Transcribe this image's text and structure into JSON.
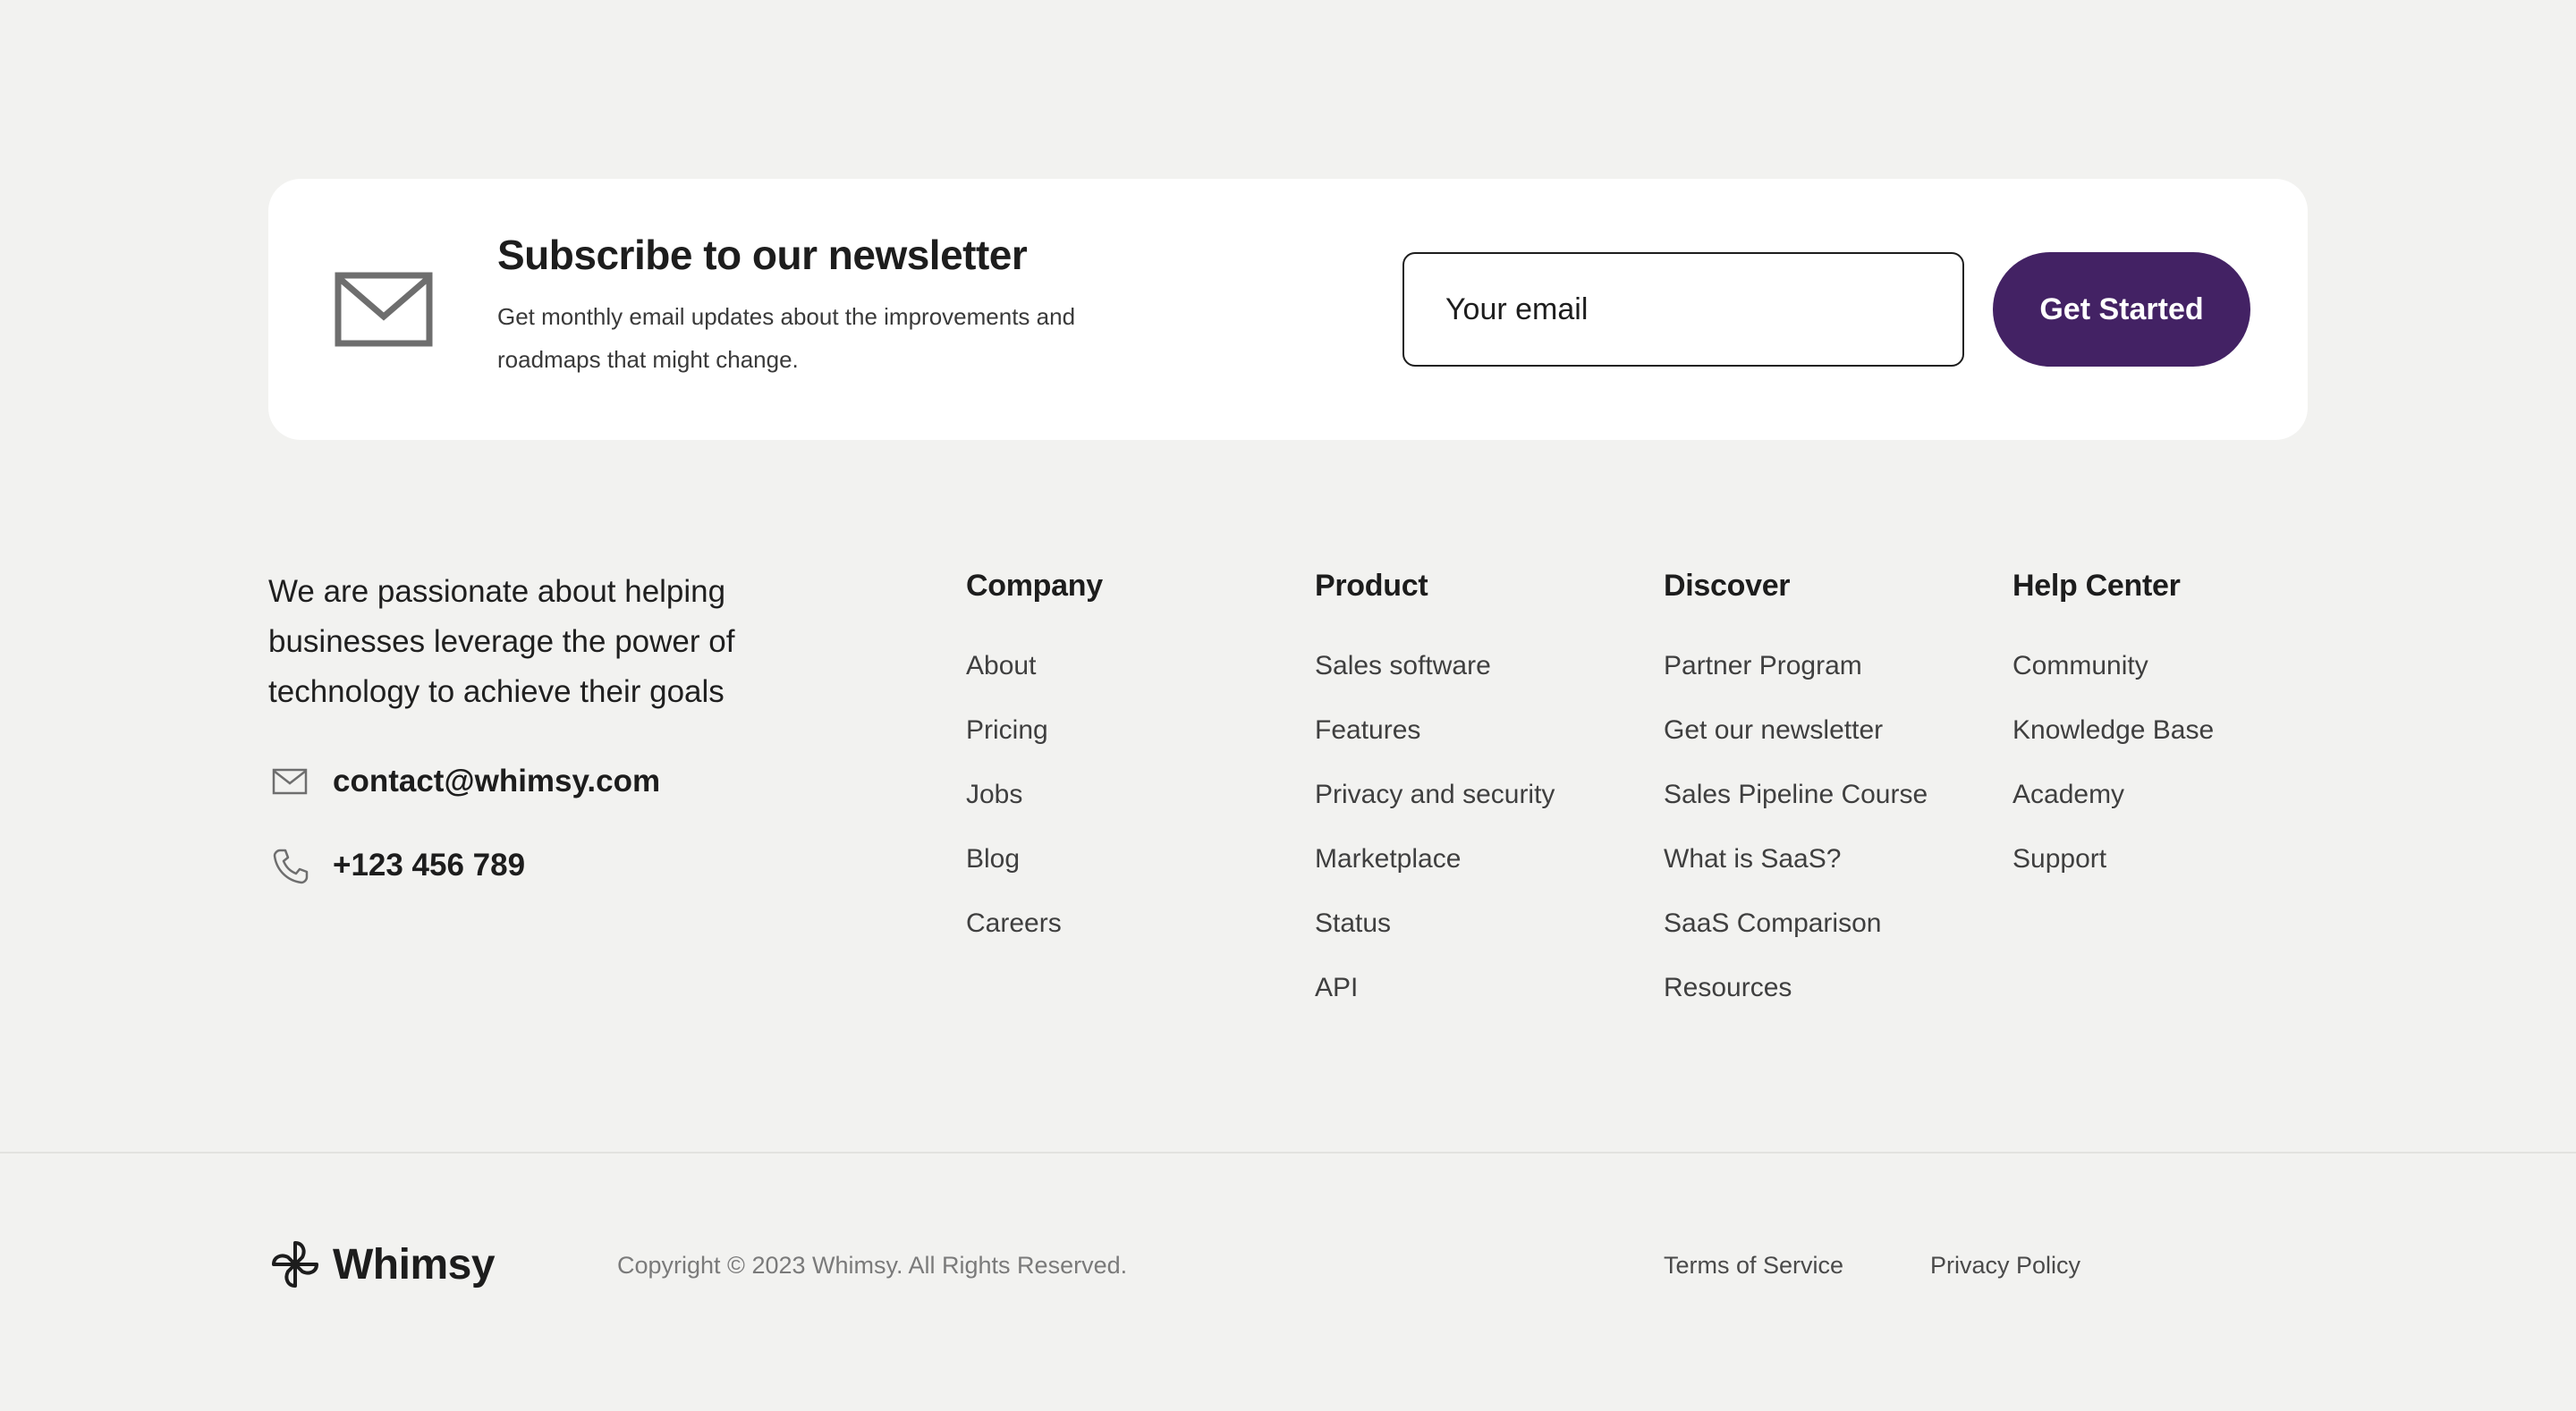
{
  "newsletter": {
    "title": "Subscribe to our newsletter",
    "description": "Get monthly email updates about the improvements and roadmaps that might change.",
    "email_placeholder": "Your email",
    "cta_label": "Get Started",
    "icon": "envelope-icon"
  },
  "about": {
    "tagline": "We are passionate about helping businesses leverage the power of technology to achieve their goals",
    "email": "contact@whimsy.com",
    "phone": "+123 456 789",
    "email_icon": "envelope-icon",
    "phone_icon": "phone-icon"
  },
  "columns": {
    "company": {
      "title": "Company",
      "links": [
        "About",
        "Pricing",
        "Jobs",
        "Blog",
        "Careers"
      ]
    },
    "product": {
      "title": "Product",
      "links": [
        "Sales software",
        "Features",
        "Privacy and security",
        "Marketplace",
        "Status",
        "API"
      ]
    },
    "discover": {
      "title": "Discover",
      "links": [
        "Partner Program",
        "Get our newsletter",
        "Sales Pipeline Course",
        "What is SaaS?",
        "SaaS Comparison",
        "Resources"
      ]
    },
    "help": {
      "title": "Help Center",
      "links": [
        "Community",
        "Knowledge Base",
        "Academy",
        "Support"
      ]
    }
  },
  "footer": {
    "brand": "Whimsy",
    "brand_icon": "pinwheel-logo-icon",
    "copyright": "Copyright © 2023 Whimsy. All Rights Reserved.",
    "terms": "Terms of Service",
    "privacy": "Privacy Policy"
  },
  "colors": {
    "accent": "#432264",
    "background": "#f2f2f0",
    "card": "#ffffff",
    "text": "#1d1d1d"
  }
}
